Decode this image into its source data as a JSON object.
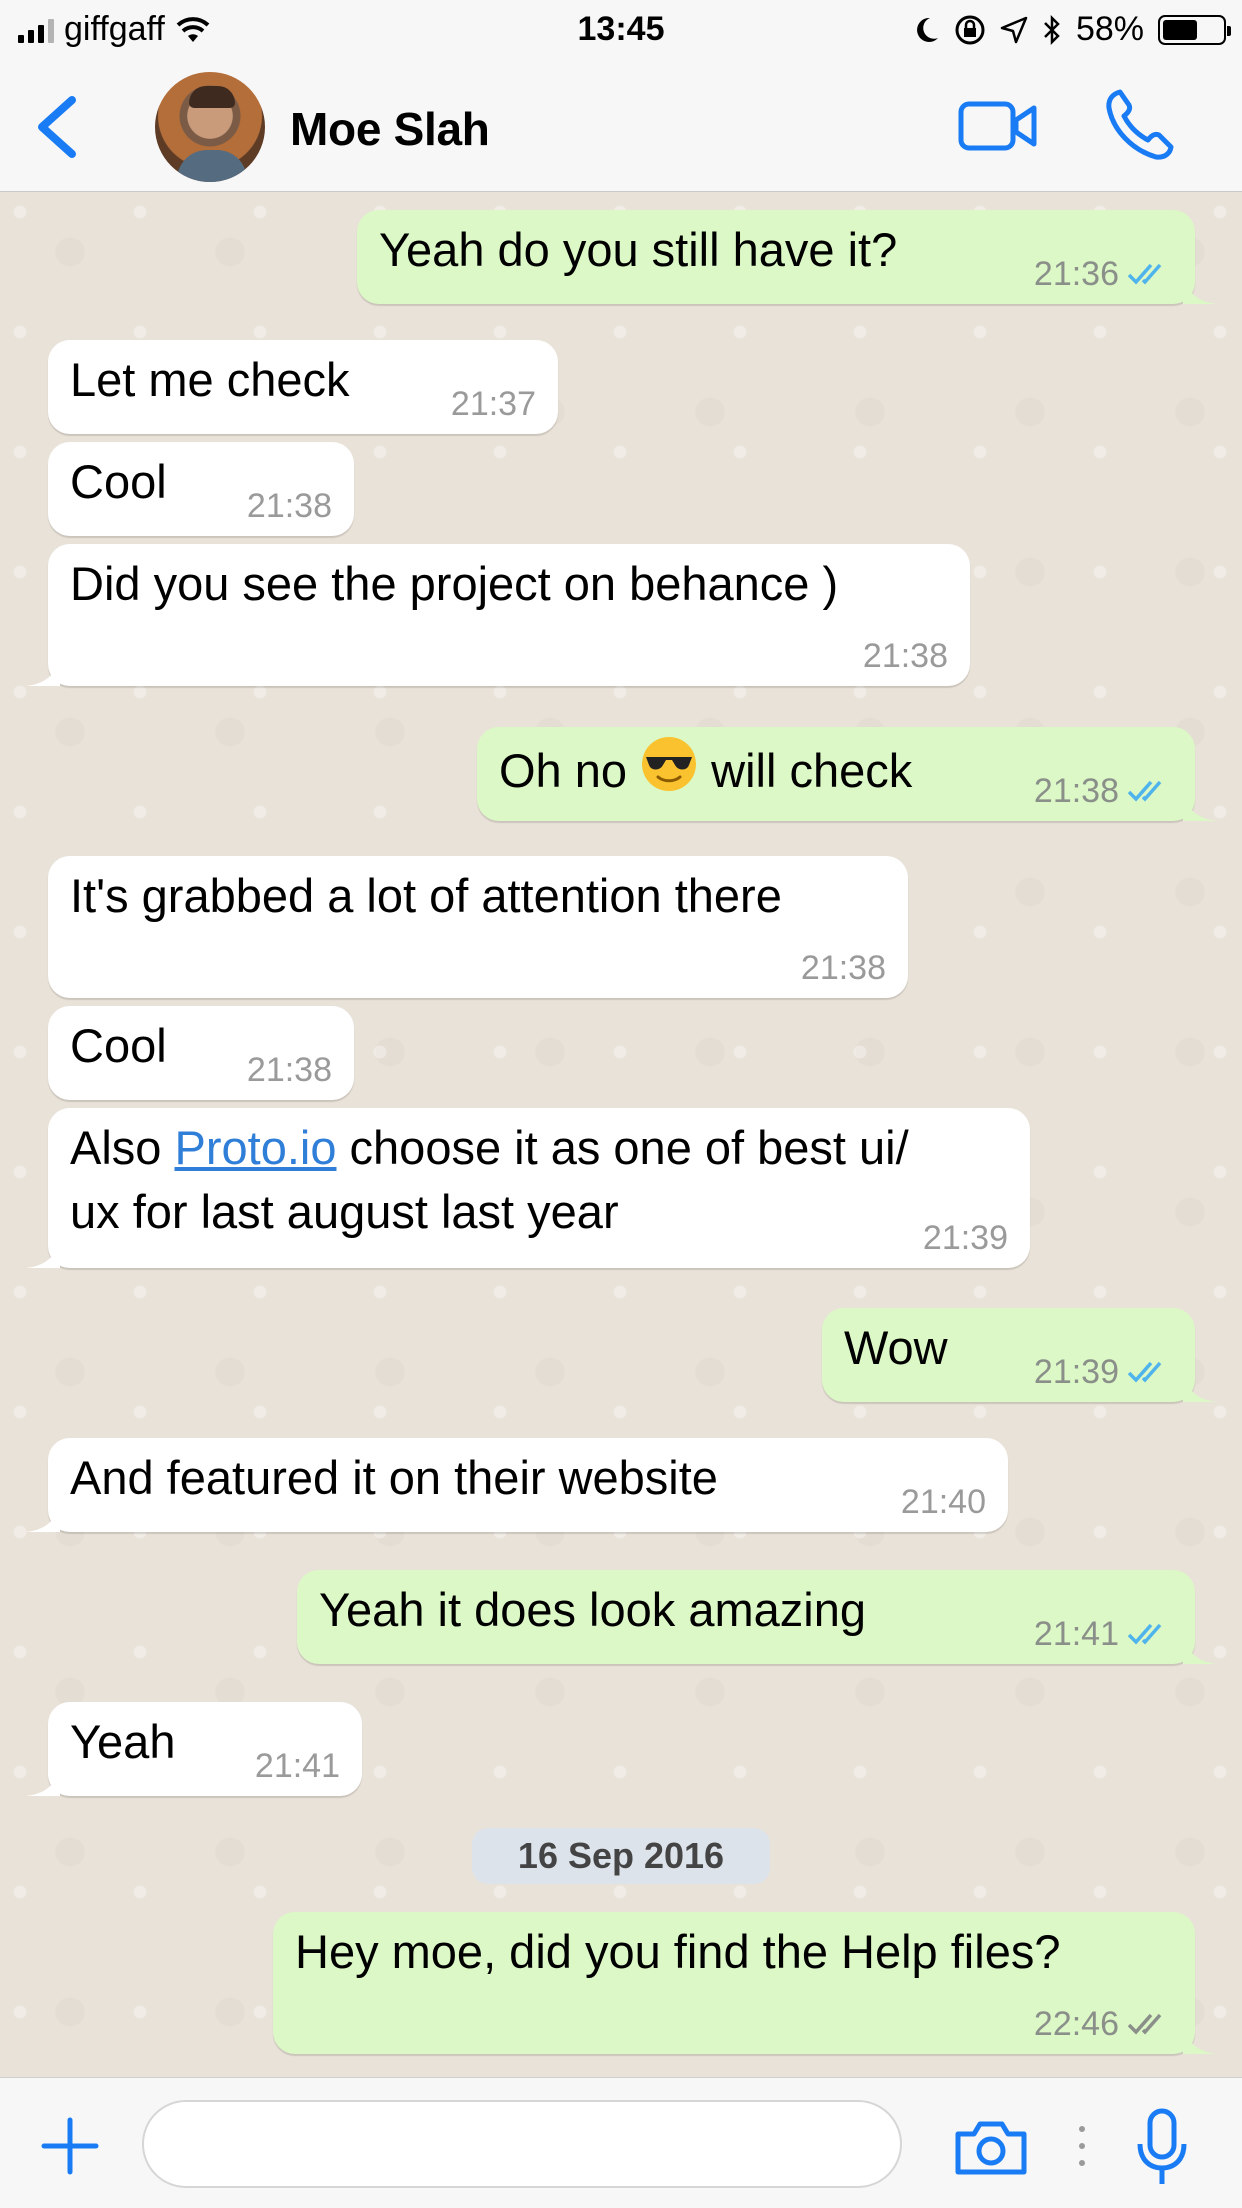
{
  "status_bar": {
    "carrier": "giffgaff",
    "time": "13:45",
    "battery": "58%",
    "battery_level": 0.58
  },
  "header": {
    "contact_name": "Moe Slah"
  },
  "messages": [
    {
      "dir": "out",
      "text": "Yeah do you still have it?",
      "time": "21:36",
      "status": "read"
    },
    {
      "dir": "in",
      "text": "Let me check",
      "time": "21:37"
    },
    {
      "dir": "in",
      "text": "Cool",
      "time": "21:38"
    },
    {
      "dir": "in",
      "text": "Did you see the project on behance )",
      "time": "21:38"
    },
    {
      "dir": "out",
      "text_before": "Oh no",
      "emoji": "sunglasses-emoji",
      "text_after": "will check",
      "time": "21:38",
      "status": "read"
    },
    {
      "dir": "in",
      "text": "It's grabbed a lot of attention there",
      "time": "21:38"
    },
    {
      "dir": "in",
      "text": "Cool",
      "time": "21:38"
    },
    {
      "dir": "in",
      "text_prefix": "Also ",
      "link": "Proto.io",
      "text_line1_suffix": " choose it as one of best ui/",
      "text_line2": "ux for last august last year",
      "time": "21:39"
    },
    {
      "dir": "out",
      "text": "Wow",
      "time": "21:39",
      "status": "read"
    },
    {
      "dir": "in",
      "text": "And featured it on their website",
      "time": "21:40"
    },
    {
      "dir": "out",
      "text": "Yeah it does look amazing",
      "time": "21:41",
      "status": "read"
    },
    {
      "dir": "in",
      "text": "Yeah",
      "time": "21:41"
    },
    {
      "dir": "out",
      "text": "Hey moe, did you find the Help files?",
      "time": "22:46",
      "status": "delivered"
    }
  ],
  "date_separator": "16 Sep 2016",
  "input_bar": {
    "placeholder": ""
  },
  "colors": {
    "accent": "#1a7cf5",
    "outgoing_bubble": "#dcf8c6",
    "incoming_bubble": "#ffffff",
    "read_tick": "#4fb4ec",
    "chat_bg": "#e9e2d8"
  }
}
